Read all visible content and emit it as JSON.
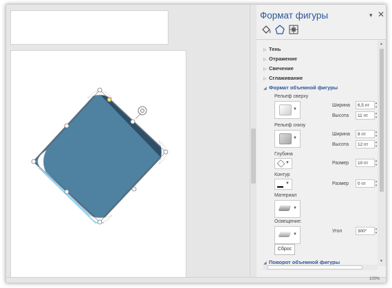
{
  "pane": {
    "title": "Формат фигуры",
    "dropdown_glyph": "▾",
    "close_glyph": "✕",
    "tab_icons": [
      "fill-line-icon",
      "effects-icon",
      "layout-properties-icon"
    ],
    "sections": {
      "shadow": "Тень",
      "reflection": "Отражение",
      "glow": "Свечение",
      "soft_edges": "Сглаживание",
      "format_3d": "Формат объемной фигуры",
      "rotation_3d": "Поворот объемной фигуры"
    },
    "bevel_top": {
      "label": "Рельеф сверху",
      "width_label": "Ширина",
      "width_value": "6,5 пт",
      "height_label": "Высота",
      "height_value": "11 пт"
    },
    "bevel_bottom": {
      "label": "Рельеф снизу",
      "width_label": "Ширина",
      "width_value": "8 пт",
      "height_label": "Высота",
      "height_value": "12 пт"
    },
    "depth": {
      "label": "Глубина",
      "size_label": "Размер",
      "size_value": "10 пт"
    },
    "contour": {
      "label": "Контур",
      "size_label": "Размер",
      "size_value": "0 пт"
    },
    "material": {
      "label": "Материал"
    },
    "lighting": {
      "label": "Освещение:",
      "angle_label": "Угол",
      "angle_value": "300°"
    },
    "reset_label": "Сброс"
  },
  "status": {
    "zoom": "100%"
  },
  "colors": {
    "accent": "#2b579a",
    "shape_fill": "#4f81a0",
    "shape_dark": "#2e4f66",
    "shape_highlight": "#9fd3ef"
  }
}
